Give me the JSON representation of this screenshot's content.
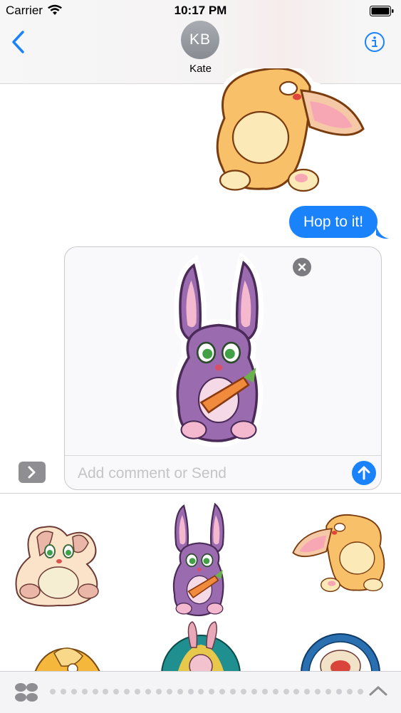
{
  "status_bar": {
    "carrier": "Carrier",
    "time": "10:17 PM",
    "icons": [
      "wifi-icon",
      "battery-icon"
    ]
  },
  "header": {
    "avatar_initials": "KB",
    "contact_name": "Kate",
    "icons": [
      "back-chevron-icon",
      "info-icon"
    ]
  },
  "messages": [
    {
      "type": "sticker",
      "sender": "me",
      "description_icon": "orange-bunny-sticker"
    },
    {
      "type": "text",
      "sender": "me",
      "text": "Hop to it!"
    }
  ],
  "compose": {
    "placeholder": "Add comment or Send",
    "staged_sticker_icon": "purple-bunny-carrot-sticker",
    "icons": [
      "remove-sticker-icon",
      "send-arrow-icon",
      "expand-chevron-icon"
    ]
  },
  "sticker_drawer": {
    "stickers": [
      "pink-bunny-sticker",
      "purple-bunny-carrot-sticker",
      "orange-bunny-sticker",
      "yellow-bunny-sticker",
      "bunny-teal-circle-sticker",
      "bunny-blue-circle-sticker"
    ]
  },
  "bottom_bar": {
    "page_dot_count": 30,
    "icons": [
      "app-drawer-icon",
      "chevron-up-icon"
    ]
  },
  "colors": {
    "accent_blue": "#1a82fb",
    "bubble_text": "#ffffff",
    "placeholder_gray": "#c4c4c8"
  }
}
